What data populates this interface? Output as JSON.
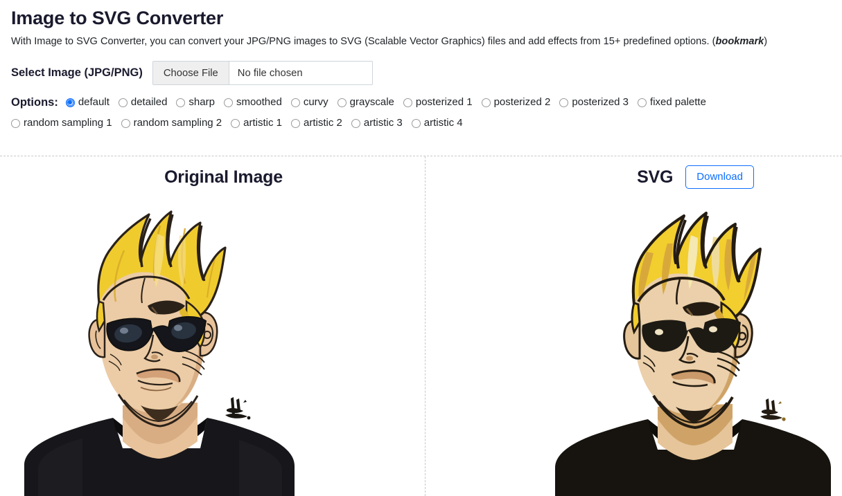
{
  "header": {
    "title": "Image to SVG Converter",
    "description_before": "With Image to SVG Converter, you can convert your JPG/PNG images to SVG (Scalable Vector Graphics) files and add effects from 15+ predefined options. (",
    "description_bookmark": "bookmark",
    "description_after": ")"
  },
  "file_select": {
    "label": "Select Image (JPG/PNG)",
    "choose_button": "Choose File",
    "file_status": "No file chosen"
  },
  "options": {
    "label": "Options:",
    "selected": "default",
    "row1": [
      {
        "label": "default",
        "checked": true
      },
      {
        "label": "detailed",
        "checked": false
      },
      {
        "label": "sharp",
        "checked": false
      },
      {
        "label": "smoothed",
        "checked": false
      },
      {
        "label": "curvy",
        "checked": false
      },
      {
        "label": "grayscale",
        "checked": false
      },
      {
        "label": "posterized 1",
        "checked": false
      },
      {
        "label": "posterized 2",
        "checked": false
      },
      {
        "label": "posterized 3",
        "checked": false
      },
      {
        "label": "fixed palette",
        "checked": false
      }
    ],
    "row2": [
      {
        "label": "random sampling 1",
        "checked": false
      },
      {
        "label": "random sampling 2",
        "checked": false
      },
      {
        "label": "artistic 1",
        "checked": false
      },
      {
        "label": "artistic 2",
        "checked": false
      },
      {
        "label": "artistic 3",
        "checked": false
      },
      {
        "label": "artistic 4",
        "checked": false
      }
    ]
  },
  "panels": {
    "left": {
      "title": "Original Image",
      "image_alt": "cartoon-portrait-blonde-pompadour-sunglasses-original"
    },
    "right": {
      "title": "SVG",
      "download_label": "Download",
      "image_alt": "cartoon-portrait-blonde-pompadour-sunglasses-vectorized"
    }
  },
  "colors": {
    "accent": "#0d6efd",
    "heading": "#1a1a2e",
    "text": "#212529",
    "divider": "#c8c8c8",
    "button_face": "#efefef",
    "hair": "#efcb2c",
    "hair_shadow": "#d2a93c",
    "skin": "#e8c9a0",
    "skin_shadow": "#c99f68",
    "shirt": "#1c1a18",
    "ink": "#1a1612"
  }
}
